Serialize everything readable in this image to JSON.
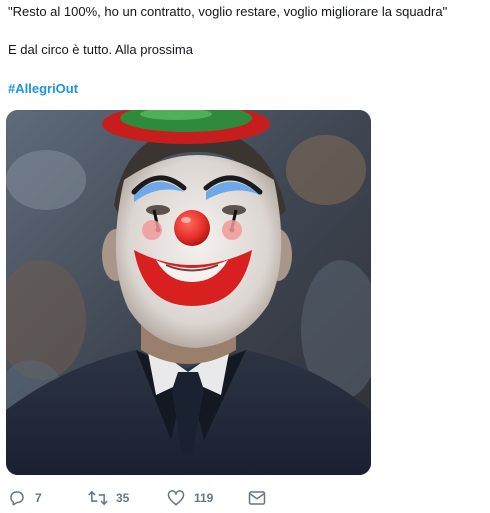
{
  "tweet": {
    "text_line1": "\"Resto al 100%, ho un contratto, voglio restare, voglio migliorare la squadra\"",
    "text_line2": "E dal circo è tutto. Alla prossima",
    "hashtag": "#AllegriOut"
  },
  "actions": {
    "reply_count": "7",
    "retweet_count": "35",
    "like_count": "119"
  },
  "icons": {
    "reply": "speech-bubble-icon",
    "retweet": "retweet-arrows-icon",
    "like": "heart-icon",
    "message": "envelope-icon"
  },
  "colors": {
    "hashtag": "#1b95e0",
    "action_gray": "#657786",
    "clown_nose": "#e8312b",
    "hat_green": "#2f8a3b"
  }
}
